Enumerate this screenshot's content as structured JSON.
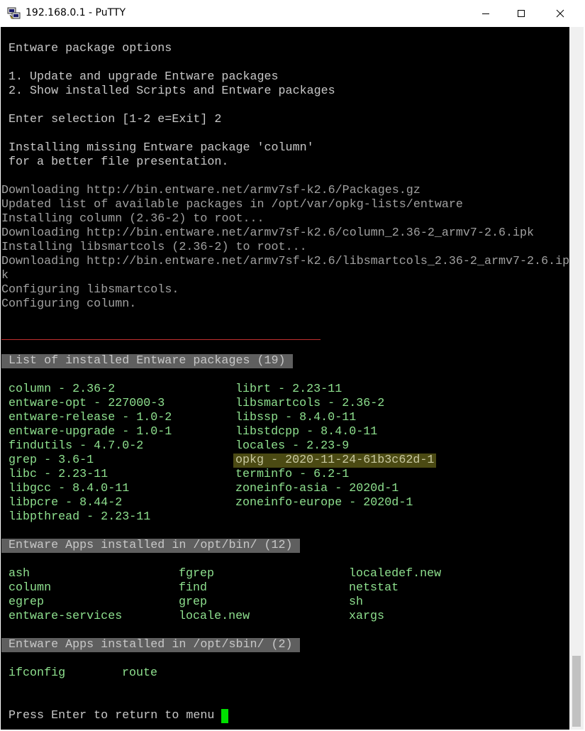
{
  "window": {
    "title": "192.168.0.1 - PuTTY",
    "app_icon": "putty-icon"
  },
  "menu": {
    "title": "Entware package options",
    "opt1": "1. Update and upgrade Entware packages",
    "opt2": "2. Show installed Scripts and Entware packages",
    "prompt": "Enter selection [1-2 e=Exit] 2",
    "install1": "Installing missing Entware package 'column'",
    "install2": "for a better file presentation."
  },
  "log": [
    "Downloading http://bin.entware.net/armv7sf-k2.6/Packages.gz",
    "Updated list of available packages in /opt/var/opkg-lists/entware",
    "Installing column (2.36-2) to root...",
    "Downloading http://bin.entware.net/armv7sf-k2.6/column_2.36-2_armv7-2.6.ipk",
    "Installing libsmartcols (2.36-2) to root...",
    "Downloading http://bin.entware.net/armv7sf-k2.6/libsmartcols_2.36-2_armv7-2.6.ip",
    "k",
    "Configuring libsmartcols.",
    "Configuring column."
  ],
  "packages": {
    "header": "List of installed Entware packages (19)",
    "left": [
      "column - 2.36-2",
      "entware-opt - 227000-3",
      "entware-release - 1.0-2",
      "entware-upgrade - 1.0-1",
      "findutils - 4.7.0-2",
      "grep - 3.6-1",
      "libc - 2.23-11",
      "libgcc - 8.4.0-11",
      "libpcre - 8.44-2",
      "libpthread - 2.23-11"
    ],
    "right": [
      "librt - 2.23-11",
      "libsmartcols - 2.36-2",
      "libssp - 8.4.0-11",
      "libstdcpp - 8.4.0-11",
      "locales - 2.23-9",
      "opkg - 2020-11-24-61b3c62d-1",
      "terminfo - 6.2-1",
      "zoneinfo-asia - 2020d-1",
      "zoneinfo-europe - 2020d-1"
    ]
  },
  "bin_apps": {
    "header": "Entware Apps installed in /opt/bin/ (12)",
    "col1": [
      "ash",
      "column",
      "egrep",
      "entware-services"
    ],
    "col2": [
      "fgrep",
      "find",
      "grep",
      "locale.new"
    ],
    "col3": [
      "localedef.new",
      "netstat",
      "sh",
      "xargs"
    ]
  },
  "sbin_apps": {
    "header": "Entware Apps installed in /opt/sbin/ (2)",
    "col1": [
      "ifconfig"
    ],
    "col2": [
      "route"
    ]
  },
  "footer": {
    "prompt": "Press Enter to return to menu"
  },
  "colors": {
    "terminal_bg": "#000000",
    "text": "#c8c8c8",
    "log_text": "#a0a0a0",
    "package_text": "#8ee08e",
    "header_bg": "#5f5f5f",
    "highlight_bg": "#4b4a13",
    "cursor": "#00e000",
    "separator": "#c03030"
  }
}
